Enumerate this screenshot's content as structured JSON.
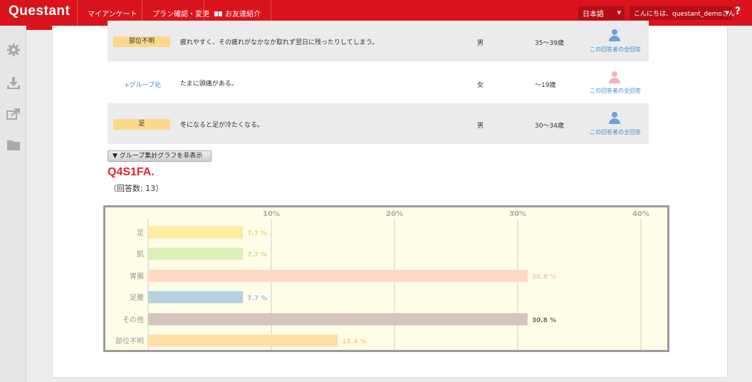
{
  "header": {
    "logo": "Questant",
    "nav": [
      "マイアンケート",
      "プラン確認・変更",
      "お友達紹介"
    ],
    "language": "日本語",
    "greeting": "こんにちは、questant_demoさん",
    "help": "?"
  },
  "rail": {
    "icons": [
      "gear-icon",
      "download-icon",
      "share-icon",
      "folder-icon"
    ]
  },
  "rows": [
    {
      "tag": "部位不明",
      "text": "疲れやすく、その疲れがなかなか取れず翌日に残ったりしてしまう。",
      "sex": "男",
      "age": "35〜39歳",
      "link": "この回答者の全回答",
      "gender": "male"
    },
    {
      "group_link": "+グループ化",
      "text": "たまに頭痛がある。",
      "sex": "女",
      "age": "〜19歳",
      "link": "この回答者の全回答",
      "gender": "female"
    },
    {
      "tag": "足",
      "text": "冬になると足が冷たくなる。",
      "sex": "男",
      "age": "30〜34歳",
      "link": "この回答者の全回答",
      "gender": "male"
    }
  ],
  "toggle_button": "▼ グループ集計グラフを非表示",
  "question": {
    "title": "Q4S1FA.",
    "count": "（回答数: 13）"
  },
  "chart_data": {
    "type": "bar",
    "orientation": "horizontal",
    "categories": [
      "足",
      "肌",
      "胃腸",
      "足腰",
      "その他",
      "部位不明"
    ],
    "values": [
      7.7,
      7.7,
      30.8,
      7.7,
      30.8,
      15.4
    ],
    "labels": [
      "7.7 %",
      "7.7 %",
      "30.8 %",
      "7.7 %",
      "30.8 %",
      "15.4 %"
    ],
    "colors": [
      "#fbeca0",
      "#dcefb6",
      "#fcd9c4",
      "#b5d1e0",
      "#d7c3bd",
      "#fde0a5"
    ],
    "label_colors": [
      "#e8d77a",
      "#c3e09a",
      "#f8c9b0",
      "#9cc0d6",
      "#7a6b66",
      "#f6cf85"
    ],
    "xticks": [
      "10%",
      "20%",
      "30%",
      "40%"
    ],
    "tick_values": [
      10,
      20,
      30,
      40
    ],
    "xlim": [
      0,
      40
    ],
    "grid": true
  }
}
